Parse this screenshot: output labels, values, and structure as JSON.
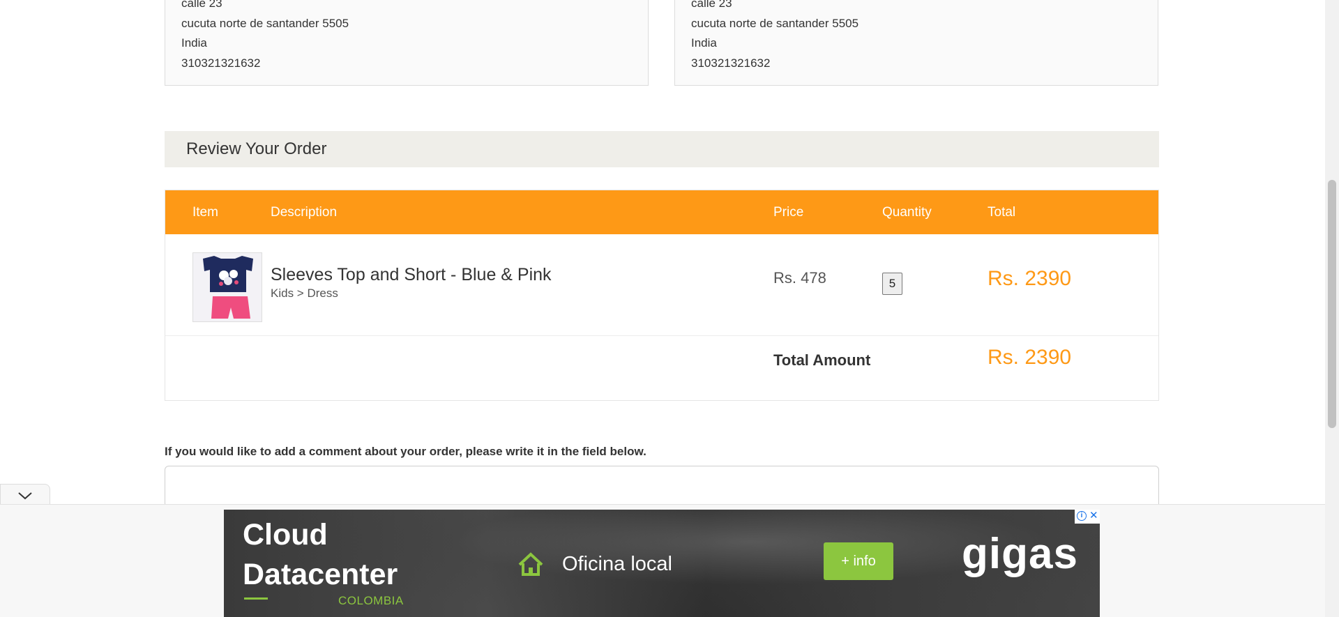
{
  "billing_address": {
    "lines": [
      "calle 23",
      "cucuta norte de santander 5505",
      "India",
      "310321321632"
    ]
  },
  "shipping_address": {
    "lines": [
      "calle 23",
      "cucuta norte de santander 5505",
      "India",
      "310321321632"
    ]
  },
  "review": {
    "title": "Review Your Order"
  },
  "order_table": {
    "headers": {
      "item": "Item",
      "description": "Description",
      "price": "Price",
      "quantity": "Quantity",
      "total": "Total"
    },
    "rows": [
      {
        "name": "Sleeves Top and Short - Blue & Pink",
        "category": "Kids > Dress",
        "price": "Rs. 478",
        "quantity": "5",
        "total": "Rs. 2390"
      }
    ],
    "total_amount_label": "Total Amount",
    "total_amount_value": "Rs. 2390"
  },
  "comment": {
    "label": "If you would like to add a comment about your order, please write it in the field below.",
    "value": ""
  },
  "ad": {
    "title_line1": "Cloud",
    "title_line2": "Datacenter",
    "country": "COLOMBIA",
    "office_text": "Oficina local",
    "info_button": "+ info",
    "brand": "gigas",
    "icon_home": "home-icon",
    "icon_info": "adchoices-info-icon",
    "icon_close": "close-icon"
  },
  "colors": {
    "accent_orange": "#fe9916",
    "review_header_bg": "#efeee9",
    "ad_green": "#8cc63f"
  }
}
